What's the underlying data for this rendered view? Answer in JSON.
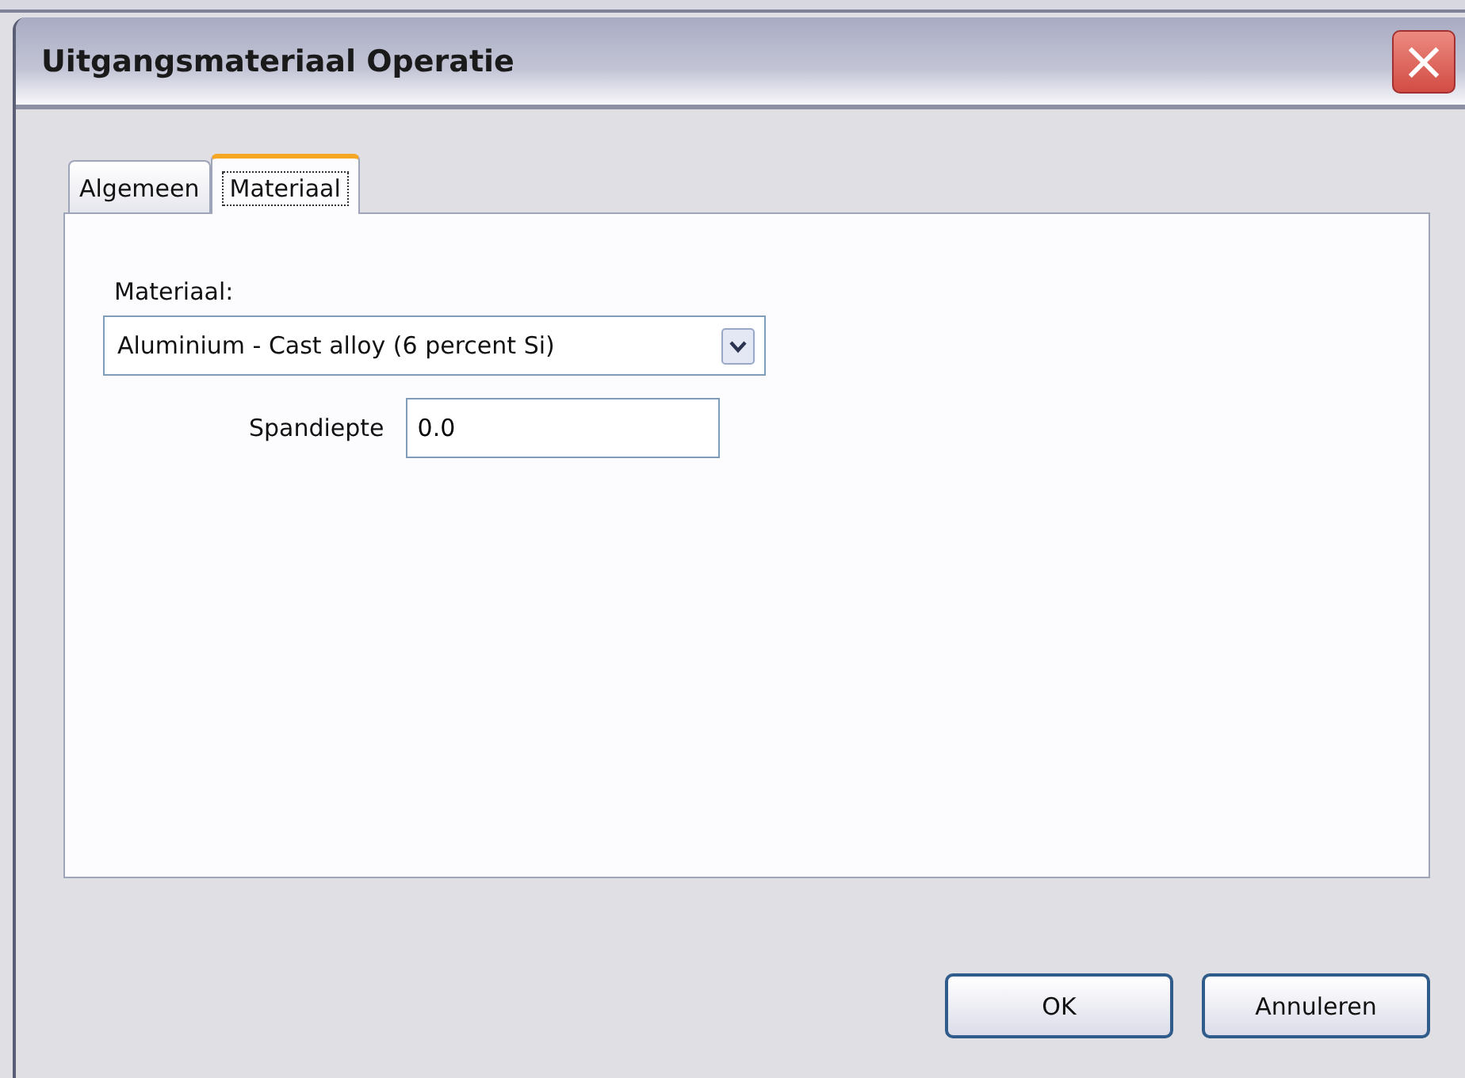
{
  "window": {
    "title": "Uitgangsmateriaal Operatie",
    "close": "×"
  },
  "tabs": [
    {
      "label": "Algemeen",
      "selected": false
    },
    {
      "label": "Materiaal",
      "selected": true
    }
  ],
  "material": {
    "label": "Materiaal:",
    "value": "Aluminium - Cast alloy (6 percent Si)"
  },
  "depth": {
    "label": "Spandiepte",
    "value": "0.0"
  },
  "buttons": [
    "OK",
    "Annuleren"
  ]
}
